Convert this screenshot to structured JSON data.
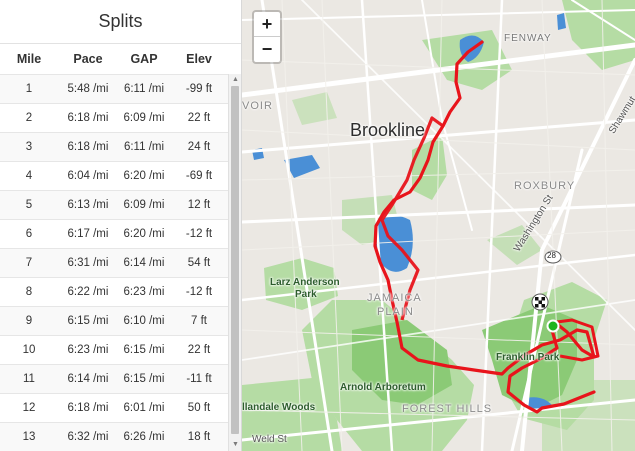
{
  "splits": {
    "title": "Splits",
    "columns": {
      "mile": "Mile",
      "pace": "Pace",
      "gap": "GAP",
      "elev": "Elev"
    },
    "rows": [
      {
        "mile": "1",
        "pace": "5:48 /mi",
        "gap": "6:11 /mi",
        "elev": "-99 ft"
      },
      {
        "mile": "2",
        "pace": "6:18 /mi",
        "gap": "6:09 /mi",
        "elev": "22 ft"
      },
      {
        "mile": "3",
        "pace": "6:18 /mi",
        "gap": "6:11 /mi",
        "elev": "24 ft"
      },
      {
        "mile": "4",
        "pace": "6:04 /mi",
        "gap": "6:20 /mi",
        "elev": "-69 ft"
      },
      {
        "mile": "5",
        "pace": "6:13 /mi",
        "gap": "6:09 /mi",
        "elev": "12 ft"
      },
      {
        "mile": "6",
        "pace": "6:17 /mi",
        "gap": "6:20 /mi",
        "elev": "-12 ft"
      },
      {
        "mile": "7",
        "pace": "6:31 /mi",
        "gap": "6:14 /mi",
        "elev": "54 ft"
      },
      {
        "mile": "8",
        "pace": "6:22 /mi",
        "gap": "6:23 /mi",
        "elev": "-12 ft"
      },
      {
        "mile": "9",
        "pace": "6:15 /mi",
        "gap": "6:10 /mi",
        "elev": "7 ft"
      },
      {
        "mile": "10",
        "pace": "6:23 /mi",
        "gap": "6:15 /mi",
        "elev": "22 ft"
      },
      {
        "mile": "11",
        "pace": "6:14 /mi",
        "gap": "6:15 /mi",
        "elev": "-11 ft"
      },
      {
        "mile": "12",
        "pace": "6:18 /mi",
        "gap": "6:01 /mi",
        "elev": "50 ft"
      },
      {
        "mile": "13",
        "pace": "6:32 /mi",
        "gap": "6:26 /mi",
        "elev": "18 ft"
      }
    ]
  },
  "map": {
    "zoom_in": "+",
    "zoom_out": "−",
    "labels": {
      "brookline": "Brookline",
      "fenway": "FENWAY",
      "roxbury": "ROXBURY",
      "jamaica_plain_1": "JAMAICA",
      "jamaica_plain_2": "PLAIN",
      "larz_1": "Larz Anderson",
      "larz_2": "Park",
      "arnold": "Arnold Arboretum",
      "franklin": "Franklin Park",
      "forest_hills": "FOREST HILLS",
      "allandale": "llandale Woods",
      "weld": "Weld St",
      "washington": "Washington St",
      "shawmut": "Shawmut",
      "voir": "VOIR",
      "route": "28"
    },
    "colors": {
      "route": "#e8141b",
      "water": "#4a8fd6",
      "park": "#8fcf7a",
      "road": "#ffffff",
      "start": "#1fb51f"
    },
    "markers": {
      "start_icon": "start-marker-icon",
      "finish_icon": "checkered-flag-icon"
    }
  },
  "scrollbar": {
    "up_icon": "scroll-up-arrow-icon",
    "down_icon": "scroll-down-arrow-icon"
  }
}
